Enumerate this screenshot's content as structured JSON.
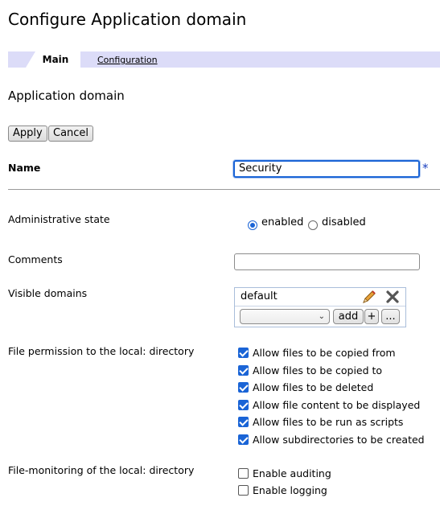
{
  "page": {
    "title": "Configure Application domain"
  },
  "tabs": [
    {
      "label": "Main"
    },
    {
      "label": "Configuration"
    }
  ],
  "section": {
    "heading": "Application domain"
  },
  "actions": {
    "apply_label": "Apply",
    "cancel_label": "Cancel"
  },
  "form": {
    "name": {
      "label": "Name",
      "value": "Security",
      "required_marker": "*"
    },
    "admin_state": {
      "label": "Administrative state",
      "enabled_label": "enabled",
      "disabled_label": "disabled",
      "selected": "enabled"
    },
    "comments": {
      "label": "Comments",
      "value": ""
    },
    "visible_domains": {
      "label": "Visible domains",
      "items": [
        "default"
      ],
      "select_value": "",
      "add_label": "add",
      "plus_label": "+",
      "more_label": "..."
    },
    "file_permission": {
      "label": "File permission to the local: directory",
      "options": [
        {
          "label": "Allow files to be copied from",
          "checked": true
        },
        {
          "label": "Allow files to be copied to",
          "checked": true
        },
        {
          "label": "Allow files to be deleted",
          "checked": true
        },
        {
          "label": "Allow file content to be displayed",
          "checked": true
        },
        {
          "label": "Allow files to be run as scripts",
          "checked": true
        },
        {
          "label": "Allow subdirectories to be created",
          "checked": true
        }
      ]
    },
    "file_monitoring": {
      "label": "File-monitoring of the local: directory",
      "options": [
        {
          "label": "Enable auditing",
          "checked": false
        },
        {
          "label": "Enable logging",
          "checked": false
        }
      ]
    }
  },
  "icons": {
    "edit": "pencil-icon",
    "delete": "close-icon"
  },
  "colors": {
    "accent": "#1a64d6",
    "tabbar": "#dcdcf8",
    "required": "#1a3fbf"
  }
}
